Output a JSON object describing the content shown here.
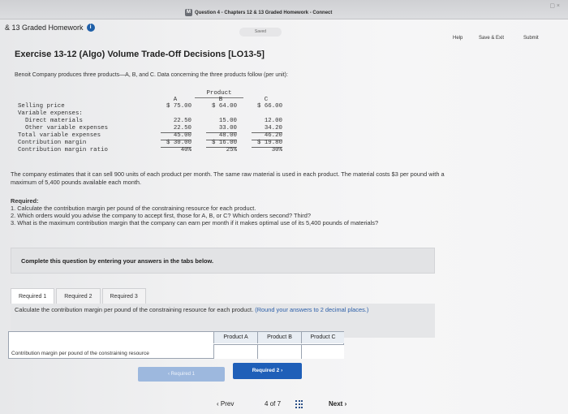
{
  "window": {
    "title": "Question 4 - Chapters 12 & 13 Graded Homework - Connect",
    "badge": "M"
  },
  "header": {
    "homework_title": "& 13 Graded Homework",
    "saved_label": "Saved",
    "help": "Help",
    "save_exit": "Save & Exit",
    "submit": "Submit"
  },
  "exercise": {
    "title": "Exercise 13-12 (Algo) Volume Trade-Off Decisions [LO13-5]",
    "intro": "Benoit Company produces three products—A, B, and C. Data concerning the three products follow (per unit):",
    "table": {
      "product_header": "Product",
      "columns": [
        "A",
        "B",
        "C"
      ],
      "rows": [
        {
          "label": "Selling price",
          "values": [
            "$ 75.00",
            "$ 64.00",
            "$ 66.00"
          ]
        },
        {
          "label": "Variable expenses:",
          "values": [
            "",
            "",
            ""
          ]
        },
        {
          "label": "  Direct materials",
          "values": [
            "22.50",
            "15.00",
            "12.00"
          ]
        },
        {
          "label": "  Other variable expenses",
          "values": [
            "22.50",
            "33.00",
            "34.20"
          ]
        },
        {
          "label": "Total variable expenses",
          "values": [
            "45.00",
            "48.00",
            "46.20"
          ]
        },
        {
          "label": "Contribution margin",
          "values": [
            "$ 30.00",
            "$ 16.00",
            "$ 19.80"
          ]
        },
        {
          "label": "Contribution margin ratio",
          "values": [
            "40%",
            "25%",
            "30%"
          ]
        }
      ]
    },
    "estimate": "The company estimates that it can sell 900 units of each product per month. The same raw material is used in each product. The material costs $3 per pound with a maximum of 5,400 pounds available each month.",
    "required_heading": "Required:",
    "required_items": [
      "1. Calculate the contribution margin per pound of the constraining resource for each product.",
      "2. Which orders would you advise the company to accept first, those for A, B, or C? Which orders second? Third?",
      "3. What is the maximum contribution margin that the company can earn per month if it makes optimal use of its 5,400 pounds of materials?"
    ],
    "complete_note": "Complete this question by entering your answers in the tabs below."
  },
  "tabs": [
    "Required 1",
    "Required 2",
    "Required 3"
  ],
  "active_tab": "Required 1",
  "panel": {
    "instruction": "Calculate the contribution margin per pound of the constraining resource for each product.",
    "hint": "(Round your answers to 2 decimal places.)",
    "grid_headers": [
      "Product A",
      "Product B",
      "Product C"
    ],
    "grid_row_label": "Contribution margin per pound of the constraining resource",
    "grid_values": [
      "",
      "",
      ""
    ],
    "prev_button": "Required 1",
    "next_button": "Required 2"
  },
  "pager": {
    "prev": "Prev",
    "page": "4",
    "of": "of",
    "total": "7",
    "next": "Next"
  },
  "colors": {
    "accent": "#1f5fb8",
    "disabled_button": "#9db8de",
    "info_icon": "#1f5fa8"
  }
}
